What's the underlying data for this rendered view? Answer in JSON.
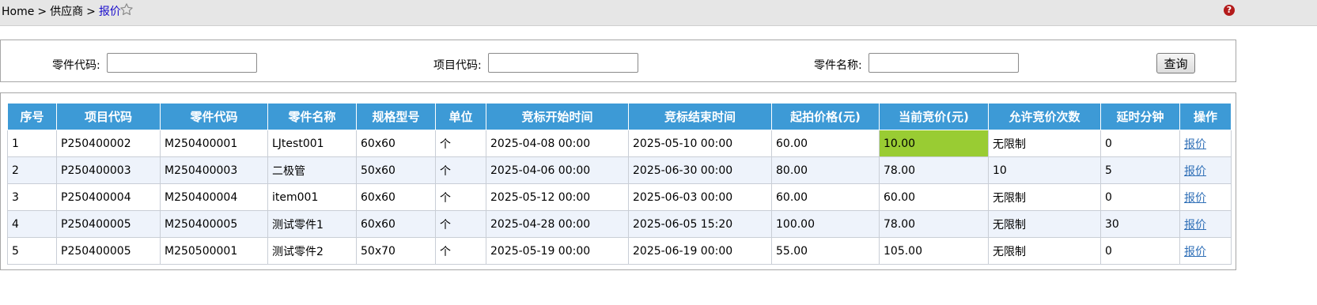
{
  "breadcrumb": {
    "home": "Home",
    "separator": ">",
    "parent": "供应商",
    "current": "报价"
  },
  "help_icon": "?",
  "search": {
    "part_code_label": "零件代码:",
    "part_code_value": "",
    "project_code_label": "项目代码:",
    "project_code_value": "",
    "part_name_label": "零件名称:",
    "part_name_value": "",
    "query_button": "查询"
  },
  "table": {
    "headers": [
      "序号",
      "项目代码",
      "零件代码",
      "零件名称",
      "规格型号",
      "单位",
      "竞标开始时间",
      "竞标结束时间",
      "起拍价格(元)",
      "当前竞价(元)",
      "允许竞价次数",
      "延时分钟",
      "操作"
    ],
    "rows": [
      [
        "1",
        "P250400002",
        "M250400001",
        "LJtest001",
        "60x60",
        "个",
        "2025-04-08 00:00",
        "2025-05-10 00:00",
        "60.00",
        "10.00",
        "无限制",
        "0",
        "报价"
      ],
      [
        "2",
        "P250400003",
        "M250400003",
        "二极管",
        "50x60",
        "个",
        "2025-04-06 00:00",
        "2025-06-30 00:00",
        "80.00",
        "78.00",
        "10",
        "5",
        "报价"
      ],
      [
        "3",
        "P250400004",
        "M250400004",
        "item001",
        "60x60",
        "个",
        "2025-05-12 00:00",
        "2025-06-03 00:00",
        "60.00",
        "60.00",
        "无限制",
        "0",
        "报价"
      ],
      [
        "4",
        "P250400005",
        "M250400005",
        "测试零件1",
        "60x60",
        "个",
        "2025-04-28 00:00",
        "2025-06-05 15:20",
        "100.00",
        "78.00",
        "无限制",
        "30",
        "报价"
      ],
      [
        "5",
        "P250400005",
        "M250500001",
        "测试零件2",
        "50x70",
        "个",
        "2025-05-19 00:00",
        "2025-06-19 00:00",
        "55.00",
        "105.00",
        "无限制",
        "0",
        "报价"
      ]
    ],
    "highlighted_cell": {
      "row": 0,
      "column": 9
    }
  },
  "icons": {
    "favorite": "star-outline-icon",
    "help": "help-icon"
  },
  "colors": {
    "header_bg": "#3d9ad6",
    "highlight_bg": "#99cc33",
    "link": "#2f6fb7",
    "crumb_current": "#1a0dcc",
    "help_icon_bg": "#b31b1b"
  }
}
